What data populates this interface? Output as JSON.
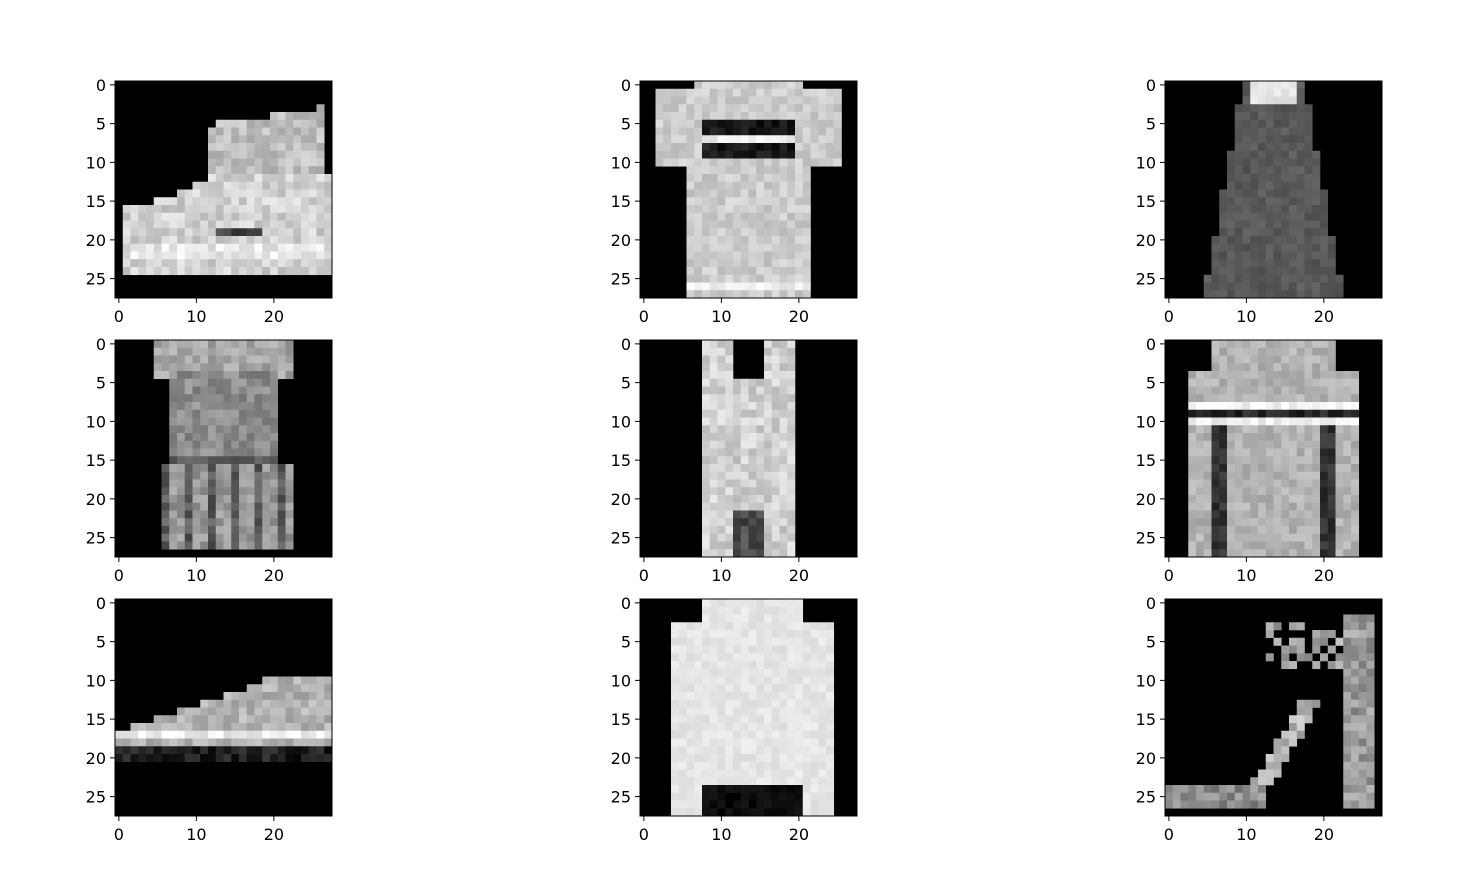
{
  "chart_data": {
    "type": "heatmap",
    "layout": "3x3 grid of grayscale 28x28 images",
    "colormap": "gray",
    "background_color": "#000000",
    "ticks": {
      "x": [
        0,
        10,
        20
      ],
      "y": [
        0,
        5,
        10,
        15,
        20,
        25
      ],
      "x_labels": [
        "0",
        "10",
        "20"
      ],
      "y_labels": [
        "0",
        "5",
        "10",
        "15",
        "20",
        "25"
      ]
    },
    "xlim": [
      -0.5,
      27.5
    ],
    "ylim": [
      27.5,
      -0.5
    ],
    "panels": [
      {
        "subject": "ankle boot"
      },
      {
        "subject": "t-shirt"
      },
      {
        "subject": "dress"
      },
      {
        "subject": "dress"
      },
      {
        "subject": "top"
      },
      {
        "subject": "pullover"
      },
      {
        "subject": "sneaker"
      },
      {
        "subject": "pullover"
      },
      {
        "subject": "sandal"
      }
    ]
  }
}
